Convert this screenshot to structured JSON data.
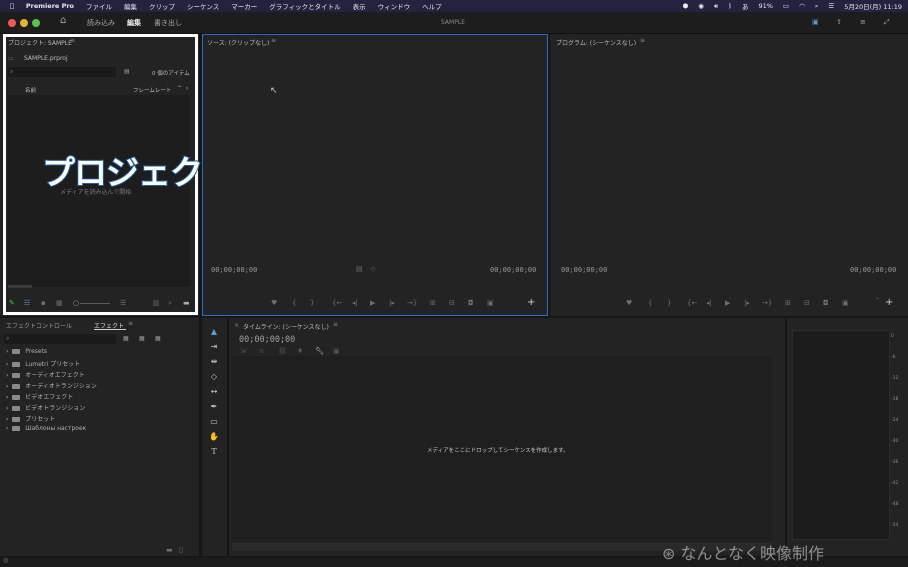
{
  "menubar": {
    "app_name": "Premiere Pro",
    "items": [
      "ファイル",
      "編集",
      "クリップ",
      "シーケンス",
      "マーカー",
      "グラフィックとタイトル",
      "表示",
      "ウィンドウ",
      "ヘルプ"
    ],
    "battery": "91%",
    "datetime": "5月20日(月)  11:19"
  },
  "header": {
    "tabs": [
      "読み込み",
      "編集",
      "書き出し"
    ],
    "title": "SAMPLE"
  },
  "project": {
    "title": "プロジェクト: SAMPLE",
    "filename": "SAMPLE.prproj",
    "item_count": "0 個のアイテム",
    "col_name": "名前",
    "col_framerate": "フレームレート",
    "empty_msg": "メディアを読み込んで開始",
    "overlay_label": "プロジェクト"
  },
  "source": {
    "title": "ソース: (クリップなし)",
    "tc_left": "00;00;00;00",
    "tc_right": "00;00;00;00"
  },
  "program": {
    "title": "プログラム: (シーケンスなし)",
    "tc_left": "00;00;00;00",
    "tc_right": "00;00;00;00"
  },
  "effects": {
    "tab_controls": "エフェクトコントロール",
    "tab_effects": "エフェクト",
    "items": [
      "Presets",
      "Lumetri プリセット",
      "オーディオエフェクト",
      "オーディオトランジション",
      "ビデオエフェクト",
      "ビデオトランジション",
      "プリセット",
      "Шаблоны настроек"
    ]
  },
  "timeline": {
    "title": "タイムライン: (シーケンスなし)",
    "timecode": "00;00;00;00",
    "drop_msg": "メディアをここにドロップしてシーケンスを作成します。"
  },
  "meter": {
    "ticks": [
      "0",
      "-6",
      "-12",
      "-18",
      "-24",
      "-30",
      "-36",
      "-42",
      "-48",
      "-54"
    ]
  },
  "watermark": "なんとなく映像制作",
  "colors": {
    "highlight_border": "#ffffff",
    "overlay_text": "#ffffff",
    "overlay_stroke": "#1f5c9a",
    "active_panel_border": "#2d6cc4"
  }
}
